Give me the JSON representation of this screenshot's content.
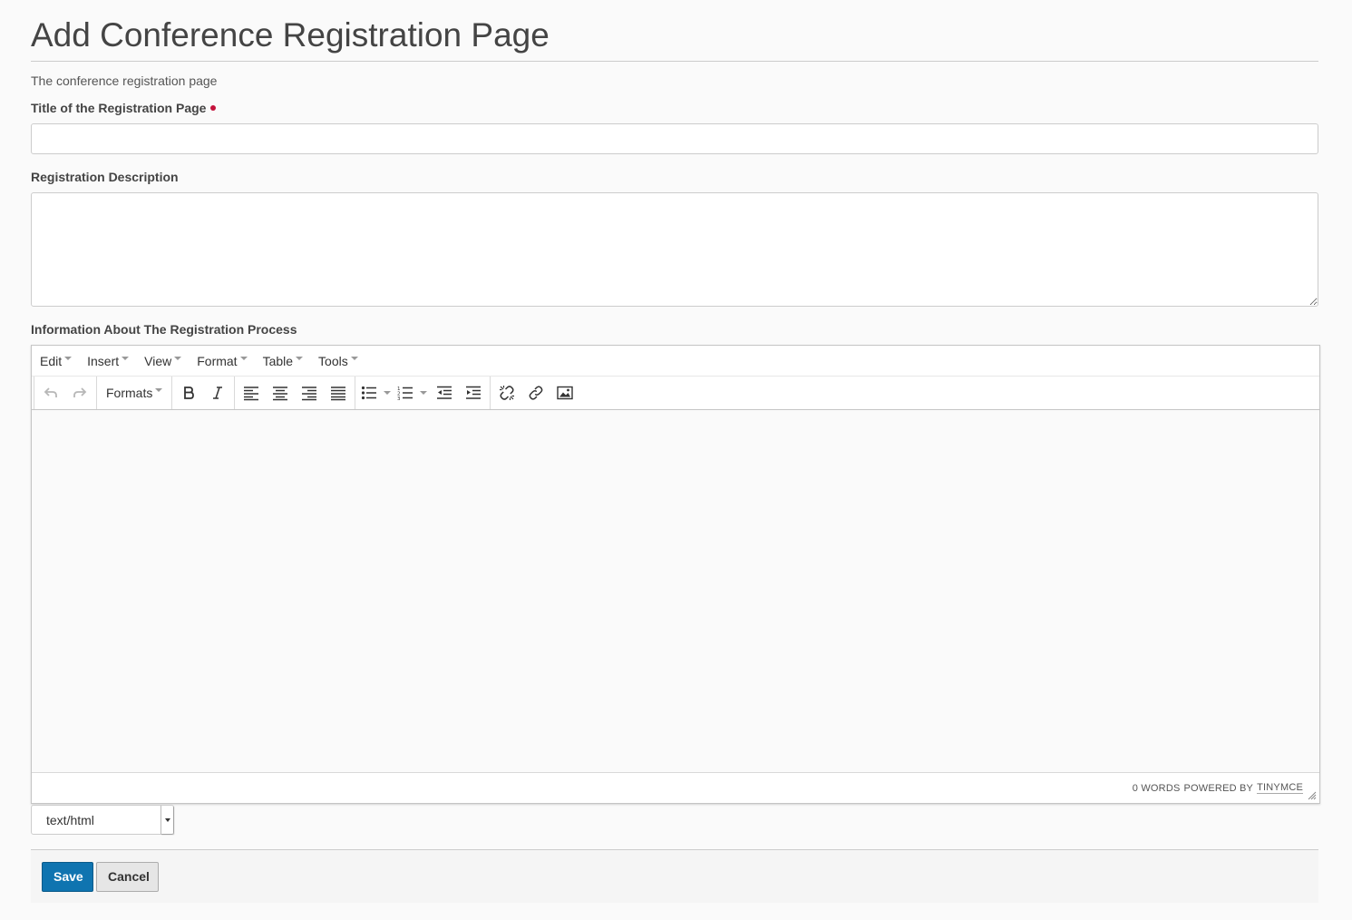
{
  "page": {
    "title": "Add Conference Registration Page",
    "description": "The conference registration page"
  },
  "form": {
    "title_label": "Title of the Registration Page",
    "title_value": "",
    "description_label": "Registration Description",
    "description_value": "",
    "info_label": "Information About The Registration Process",
    "format_value": "text/html"
  },
  "editor": {
    "menu": [
      "Edit",
      "Insert",
      "View",
      "Format",
      "Table",
      "Tools"
    ],
    "formats_label": "Formats",
    "word_count": "0 words",
    "powered_by": "Powered by",
    "powered_link": "TinyMCE"
  },
  "actions": {
    "save_label": "Save",
    "cancel_label": "Cancel"
  },
  "colors": {
    "required": "#c4123b",
    "save_button": "#0f74b0"
  }
}
